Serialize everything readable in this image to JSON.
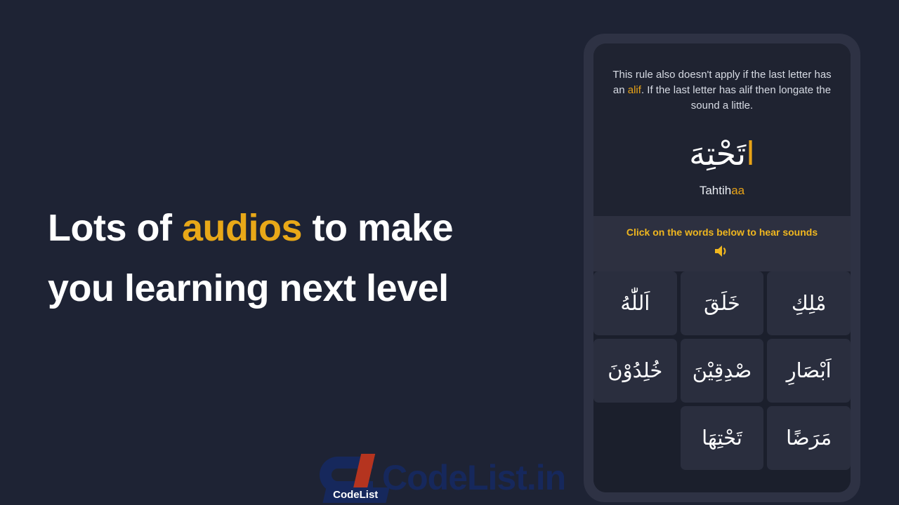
{
  "page": {
    "background_color": "#1e2334",
    "accent_color": "#e8a818"
  },
  "headline": {
    "line1_before": "Lots of ",
    "line1_accent": "audios",
    "line1_after": " to make",
    "line2": "you learning next level"
  },
  "watermark": {
    "logo_label": "CodeList",
    "brand_text": "CodeList.in",
    "navy": "#16285c",
    "red": "#b5341f"
  },
  "phone": {
    "lesson": {
      "description_part1": "This rule also doesn't apply if the last letter has an ",
      "description_accent": "alif",
      "description_part2": ". If the last letter has alif then longate the sound a little.",
      "arabic_word_main": "تَحْتِهَ",
      "arabic_word_accent": "ا",
      "transliteration_main": "Tahtih",
      "transliteration_accent": "aa"
    },
    "click_band": {
      "prompt": "Click on the words below to hear sounds",
      "speaker_icon": "speaker-icon",
      "icon_color": "#f0b71f"
    },
    "word_grid": {
      "tiles": [
        {
          "arabic": "اَللّٰهُ",
          "empty": false
        },
        {
          "arabic": "خَلَقَ",
          "empty": false
        },
        {
          "arabic": "مْلِكِ",
          "empty": false
        },
        {
          "arabic": "خُلِدُوْنَ",
          "empty": false
        },
        {
          "arabic": "صْدِقِيْنَ",
          "empty": false
        },
        {
          "arabic": "اَبْصَارِ",
          "empty": false
        },
        {
          "arabic": "",
          "empty": true
        },
        {
          "arabic": "تَحْتِهَا",
          "empty": false
        },
        {
          "arabic": "مَرَضًا",
          "empty": false
        }
      ]
    }
  }
}
